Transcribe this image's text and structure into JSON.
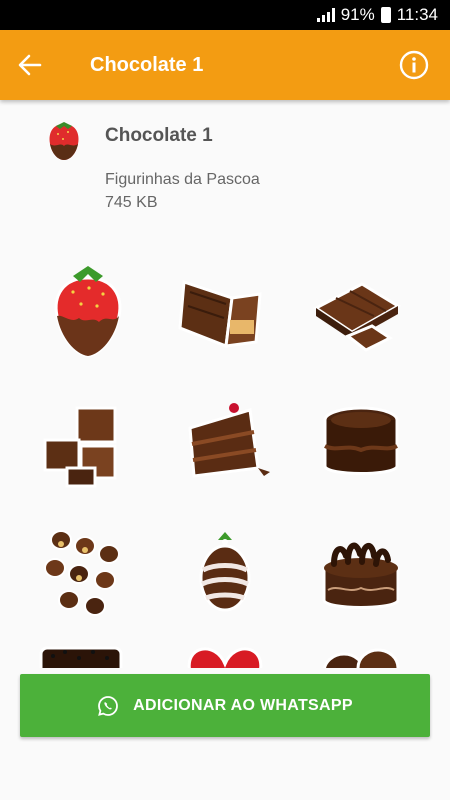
{
  "status_bar": {
    "battery": "91%",
    "time": "11:34"
  },
  "app_bar": {
    "title": "Chocolate 1"
  },
  "pack": {
    "title": "Chocolate 1",
    "publisher": "Figurinhas da Pascoa",
    "size": "745 KB"
  },
  "stickers": [
    "strawberry-chocolate",
    "chocolate-bar",
    "chocolate-pieces",
    "chocolate-cubes",
    "chocolate-cake-slice",
    "chocolate-round-cake",
    "chocolate-bonbons",
    "chocolate-egg",
    "chocolate-curl-cake",
    "chocolate-sprinkle-bar",
    "heart-chocolate",
    "chocolate-truffles"
  ],
  "add_button": {
    "label": "ADICIONAR AO WHATSAPP",
    "icon": "whatsapp-icon",
    "color": "#4cb13a"
  },
  "colors": {
    "app_bar": "#f39c12"
  }
}
